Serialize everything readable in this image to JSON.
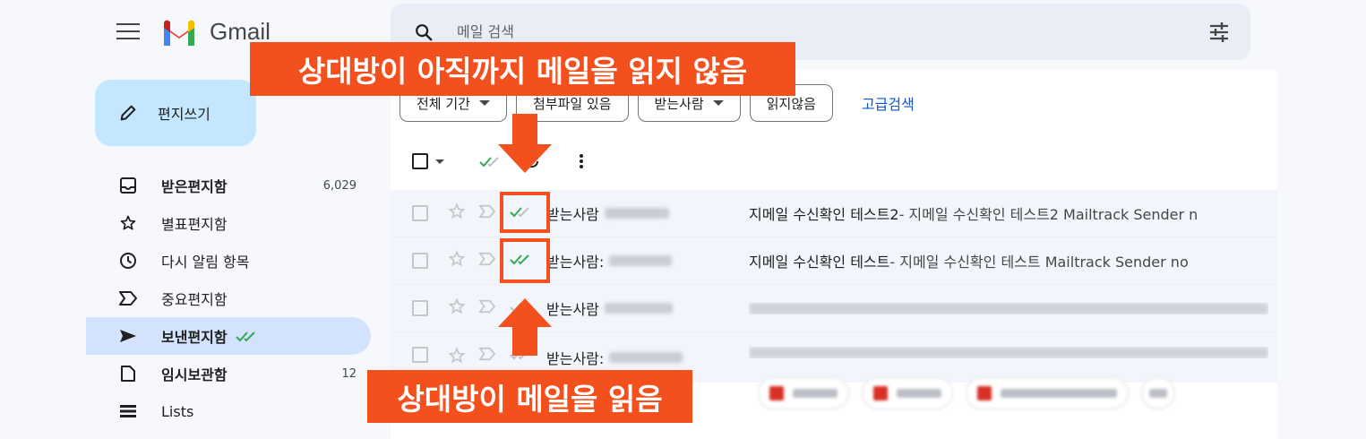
{
  "app": {
    "name": "Gmail"
  },
  "compose": {
    "label": "편지쓰기"
  },
  "search": {
    "placeholder": "메일 검색"
  },
  "nav": [
    {
      "label": "받은편지함",
      "count": "6,029",
      "icon": "inbox-icon",
      "bold": true
    },
    {
      "label": "별표편지함",
      "count": "",
      "icon": "star-icon",
      "bold": false
    },
    {
      "label": "다시 알림 항목",
      "count": "",
      "icon": "clock-icon",
      "bold": false
    },
    {
      "label": "중요편지함",
      "count": "",
      "icon": "important-icon",
      "bold": false
    },
    {
      "label": "보낸편지함",
      "count": "",
      "icon": "send-icon",
      "bold": true,
      "active": true
    },
    {
      "label": "임시보관함",
      "count": "12",
      "icon": "draft-icon",
      "bold": true
    },
    {
      "label": "Lists",
      "count": "",
      "icon": "lists-icon",
      "bold": false
    }
  ],
  "filters": {
    "period": "전체 기간",
    "attachment": "첨부파일 있음",
    "recipient": "받는사람",
    "unread": "읽지않음",
    "advanced": "고급검색"
  },
  "rows": [
    {
      "sender_label": "받는사람",
      "subject": "지메일 수신확인 테스트2",
      "snippet": " - 지메일 수신확인 테스트2 Mailtrack Sender n"
    },
    {
      "sender_label": "받는사람:",
      "subject": "지메일 수신확인 테스트",
      "snippet": " - 지메일 수신확인 테스트 Mailtrack Sender no"
    },
    {
      "sender_label": "받는사람",
      "subject": "",
      "snippet": ""
    },
    {
      "sender_label": "받는사람:",
      "subject": "",
      "snippet": ""
    }
  ],
  "annotations": {
    "top": "상대방이 아직까지 메일을 읽지 않음",
    "bottom": "상대방이 메일을 읽음"
  },
  "colors": {
    "accent": "#f4501e",
    "compose_bg": "#c2e7ff",
    "active_nav": "#d3e3fd",
    "check_green": "#34a853",
    "check_gray": "#bdc1c6"
  }
}
